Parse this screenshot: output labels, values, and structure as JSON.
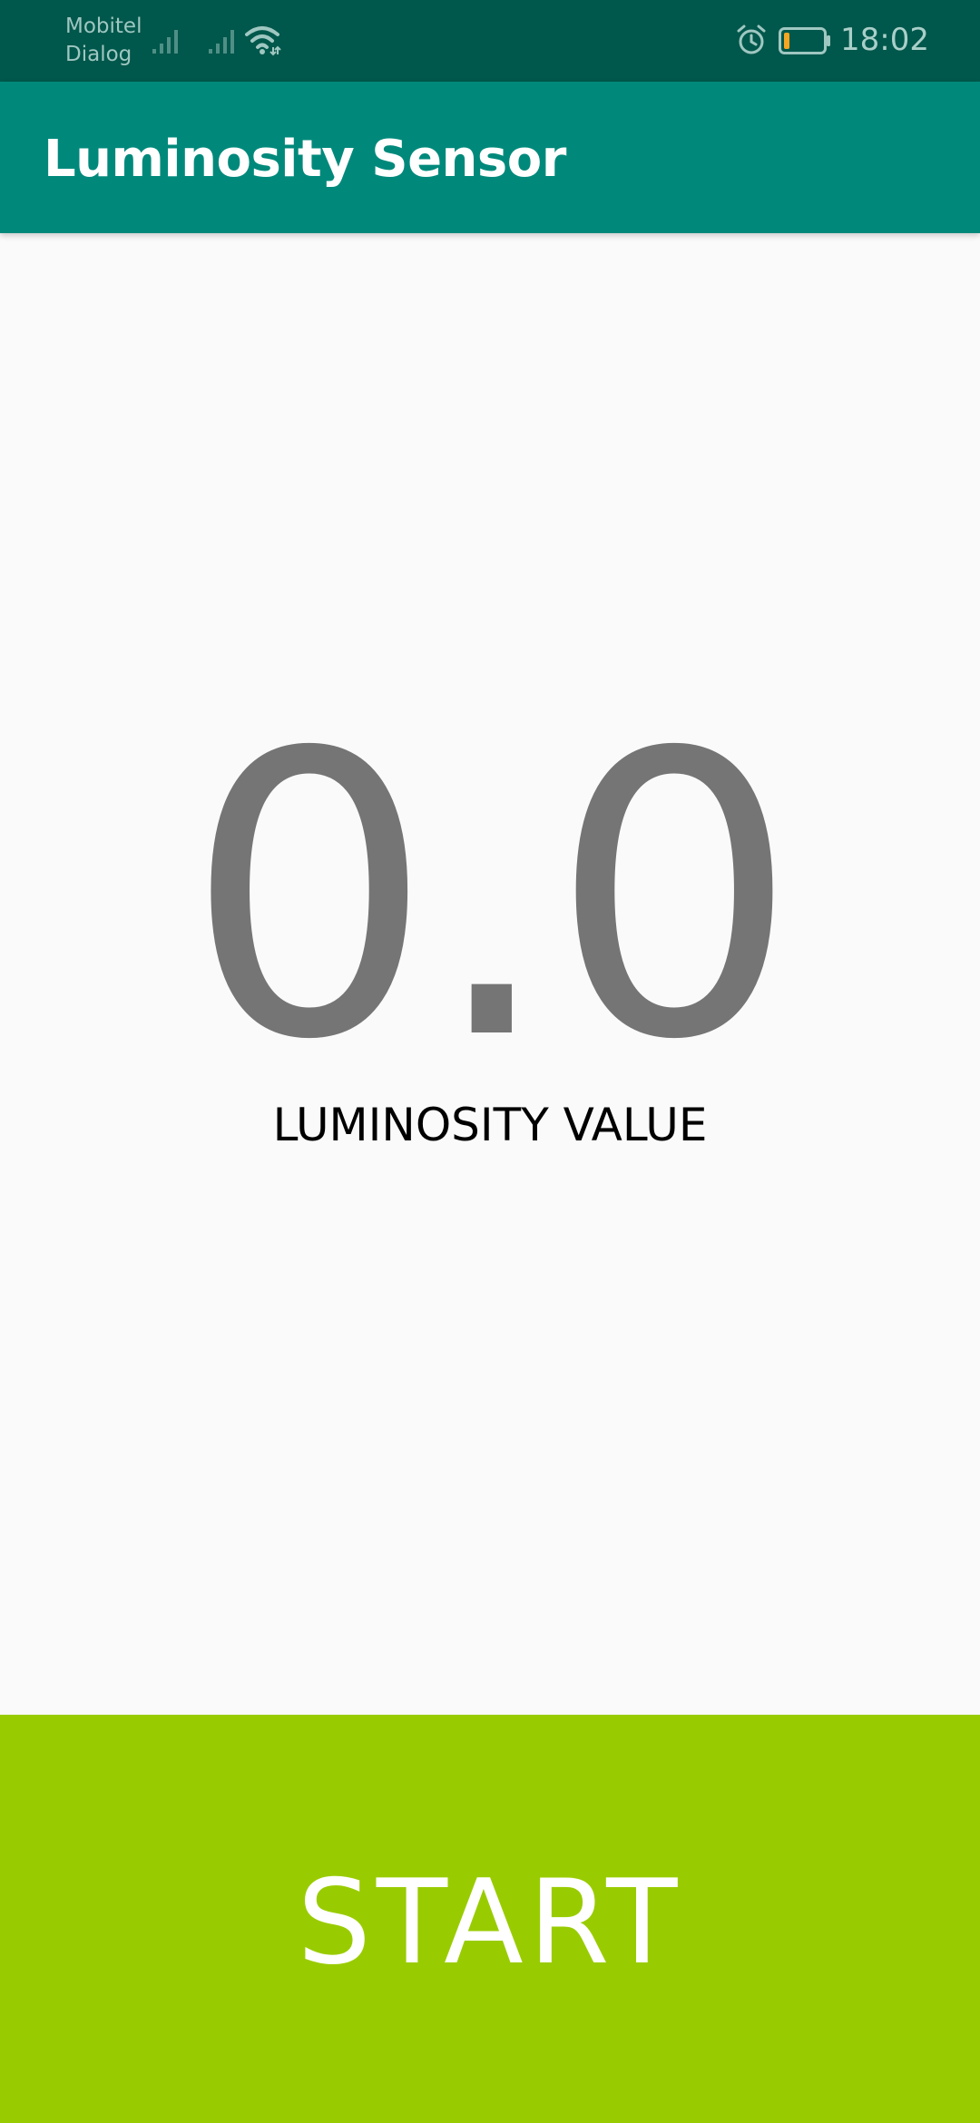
{
  "status_bar": {
    "carrier_1": "Mobitel",
    "carrier_2": "Dialog",
    "time": "18:02",
    "icons": [
      "signal-icon",
      "signal-icon",
      "wifi-icon",
      "alarm-icon",
      "battery-icon"
    ],
    "battery_level": 0.15,
    "battery_color": "#f5a623"
  },
  "app_bar": {
    "title": "Luminosity Sensor",
    "color": "#00897b"
  },
  "main": {
    "value": "0.0",
    "label": "LUMINOSITY VALUE"
  },
  "start_button": {
    "label": "START",
    "color": "#99cc00"
  }
}
